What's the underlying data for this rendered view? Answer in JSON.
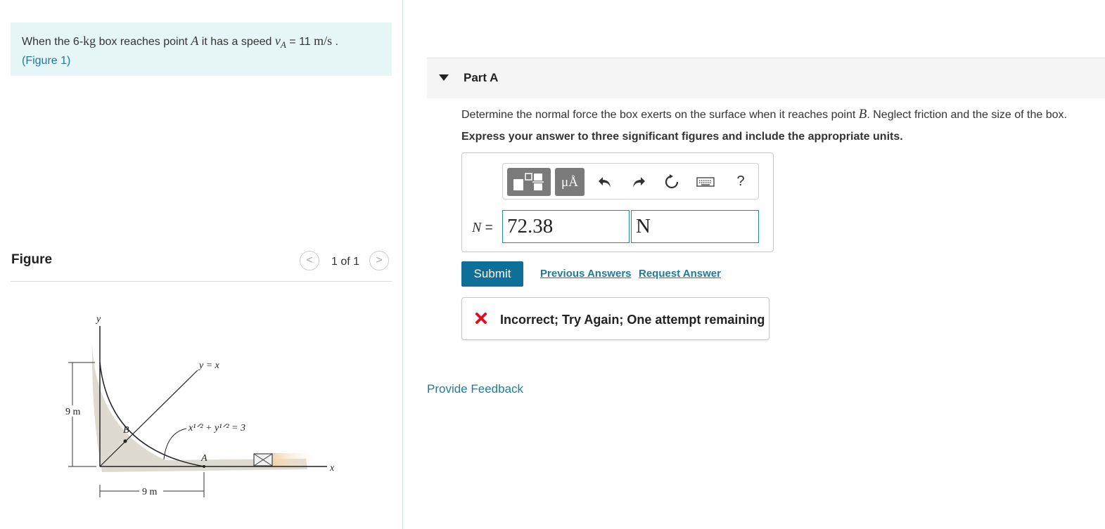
{
  "problem": {
    "text_prefix": "When the 6-",
    "mass_unit": "kg",
    "text_mid1": " box reaches point ",
    "point_a": "A",
    "text_mid2": " it has a speed ",
    "speed_symbol": "v",
    "speed_subscript": "A",
    "speed_equals": " = 11 ",
    "speed_unit": " m/s",
    "text_end": " .",
    "figure_link_open": "(",
    "figure_link": "Figure 1",
    "figure_link_close": ")"
  },
  "figure": {
    "title": "Figure",
    "pager": "1 of 1",
    "prev_glyph": "<",
    "next_glyph": ">",
    "labels": {
      "y_axis": "y",
      "x_axis": "x",
      "line_eq": "y = x",
      "curve_eq": "x¹ᐟ² + y¹ᐟ² = 3",
      "point_b": "B",
      "point_a": "A",
      "dim_vertical": "9 m",
      "dim_horizontal": "9 m"
    }
  },
  "part": {
    "title": "Part A",
    "question_prefix": "Determine the normal force the box exerts on the surface when it reaches point ",
    "question_point": "B",
    "question_suffix": ". Neglect friction and the size of the box.",
    "instruction": "Express your answer to three significant figures and include the appropriate units."
  },
  "answer": {
    "variable": "N",
    "equals": " =",
    "value": "72.38",
    "units": "N",
    "units_button_label": "μÅ",
    "help_label": "?"
  },
  "actions": {
    "submit": "Submit",
    "previous_answers": "Previous Answers",
    "request_answer": "Request Answer"
  },
  "feedback": {
    "message": "Incorrect; Try Again; One attempt remaining",
    "icon": "x-icon",
    "icon_color": "#d9141e"
  },
  "footer": {
    "provide_feedback": "Provide Feedback"
  },
  "colors": {
    "accent": "#0e6f99",
    "link": "#1f7a9c",
    "problem_bg": "#e6f6f7"
  }
}
